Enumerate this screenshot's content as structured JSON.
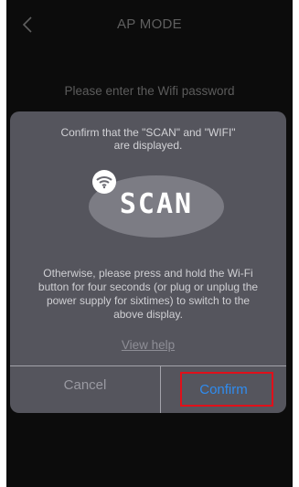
{
  "header": {
    "title": "AP MODE",
    "back_icon": "chevron-left-icon"
  },
  "prompt": "Please enter the Wifi password",
  "dialog": {
    "confirm_line1": "Confirm that the \"SCAN\" and \"WIFI\"",
    "confirm_line2": "are displayed.",
    "display_text": "SCAN",
    "wifi_icon": "wifi-icon",
    "instructions_line1": "Otherwise, please press and hold the Wi-Fi",
    "instructions_line2": "button for four seconds (or plug or unplug the",
    "instructions_line3": "power supply for sixtimes) to switch to the",
    "instructions_line4": "above display.",
    "help_link": "View help",
    "cancel_label": "Cancel",
    "confirm_label": "Confirm"
  },
  "colors": {
    "background": "#0c0c0c",
    "dialog": "#55555d",
    "accent": "#2f8cf0",
    "highlight": "#e0101a"
  }
}
